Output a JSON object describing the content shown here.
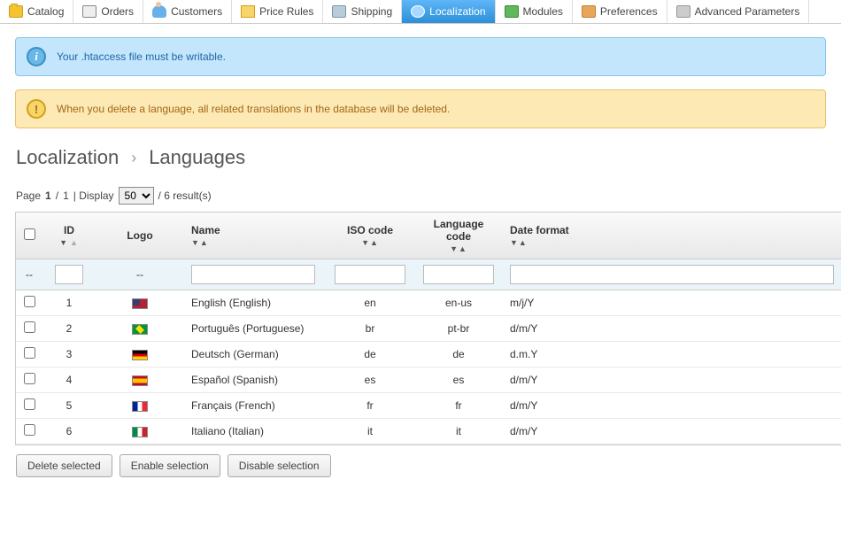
{
  "nav": {
    "items": [
      {
        "label": "Catalog",
        "icon": "folder"
      },
      {
        "label": "Orders",
        "icon": "cart"
      },
      {
        "label": "Customers",
        "icon": "person"
      },
      {
        "label": "Price Rules",
        "icon": "tag"
      },
      {
        "label": "Shipping",
        "icon": "truck"
      },
      {
        "label": "Localization",
        "icon": "globe",
        "active": true
      },
      {
        "label": "Modules",
        "icon": "puzzle"
      },
      {
        "label": "Preferences",
        "icon": "slider"
      },
      {
        "label": "Advanced Parameters",
        "icon": "wrench"
      }
    ]
  },
  "alerts": {
    "info": "Your .htaccess file must be writable.",
    "warn": "When you delete a language, all related translations in the database will be deleted."
  },
  "breadcrumb": {
    "section": "Localization",
    "page": "Languages"
  },
  "pager": {
    "prefix": "Page",
    "page_current": "1",
    "page_sep": "/",
    "page_total": "1",
    "display_label": "| Display",
    "display_value": "50",
    "results_suffix": "/ 6 result(s)"
  },
  "table": {
    "columns": {
      "id": "ID",
      "logo": "Logo",
      "name": "Name",
      "iso": "ISO code",
      "lang": "Language code",
      "date": "Date format"
    },
    "filter_dash": "--",
    "rows": [
      {
        "id": "1",
        "flag": "us",
        "name": "English (English)",
        "iso": "en",
        "lang": "en-us",
        "date": "m/j/Y"
      },
      {
        "id": "2",
        "flag": "br",
        "name": "Português (Portuguese)",
        "iso": "br",
        "lang": "pt-br",
        "date": "d/m/Y"
      },
      {
        "id": "3",
        "flag": "de",
        "name": "Deutsch (German)",
        "iso": "de",
        "lang": "de",
        "date": "d.m.Y"
      },
      {
        "id": "4",
        "flag": "es",
        "name": "Español (Spanish)",
        "iso": "es",
        "lang": "es",
        "date": "d/m/Y"
      },
      {
        "id": "5",
        "flag": "fr",
        "name": "Français (French)",
        "iso": "fr",
        "lang": "fr",
        "date": "d/m/Y"
      },
      {
        "id": "6",
        "flag": "it",
        "name": "Italiano (Italian)",
        "iso": "it",
        "lang": "it",
        "date": "d/m/Y"
      }
    ]
  },
  "actions": {
    "delete": "Delete selected",
    "enable": "Enable selection",
    "disable": "Disable selection"
  }
}
